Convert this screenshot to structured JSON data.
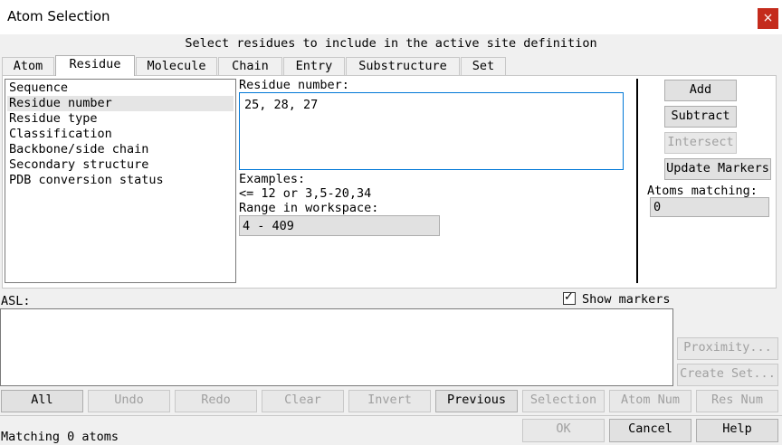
{
  "window": {
    "title": "Atom Selection",
    "close_glyph": "×"
  },
  "subtitle": "Select residues to include in the active site definition",
  "tabs": [
    {
      "label": "Atom"
    },
    {
      "label": "Residue"
    },
    {
      "label": "Molecule"
    },
    {
      "label": "Chain"
    },
    {
      "label": "Entry"
    },
    {
      "label": "Substructure"
    },
    {
      "label": "Set"
    }
  ],
  "active_tab": "Residue",
  "criteria": [
    {
      "label": "Sequence"
    },
    {
      "label": "Residue number"
    },
    {
      "label": "Residue type"
    },
    {
      "label": "Classification"
    },
    {
      "label": "Backbone/side chain"
    },
    {
      "label": "Secondary structure"
    },
    {
      "label": "PDB conversion status"
    }
  ],
  "selected_criterion": "Residue number",
  "residue_number": {
    "label": "Residue number:",
    "value": "25, 28, 27",
    "examples_label": "Examples:",
    "examples_value": "<= 12 or 3,5-20,34",
    "range_label": "Range in workspace:",
    "range_value": "4 - 409"
  },
  "actions": {
    "add": "Add",
    "subtract": "Subtract",
    "intersect": "Intersect",
    "update_markers": "Update Markers",
    "atoms_matching_label": "Atoms matching:",
    "atoms_matching_value": "0"
  },
  "asl": {
    "label": "ASL:",
    "value": ""
  },
  "show_markers": {
    "label": "Show markers",
    "checked": true,
    "check_glyph": "✓"
  },
  "side_buttons": {
    "proximity": "Proximity...",
    "create_set": "Create Set..."
  },
  "toolbar": {
    "all": "All",
    "undo": "Undo",
    "redo": "Redo",
    "clear": "Clear",
    "invert": "Invert",
    "previous": "Previous",
    "selection": "Selection",
    "atom_num": "Atom Num",
    "res_num": "Res Num"
  },
  "status": "Matching 0 atoms",
  "dialog_buttons": {
    "ok": "OK",
    "cancel": "Cancel",
    "help": "Help"
  },
  "colors": {
    "close_button": "#c42b1c",
    "focus_border": "#0078d7",
    "selection_bg": "#e5e5e5"
  }
}
